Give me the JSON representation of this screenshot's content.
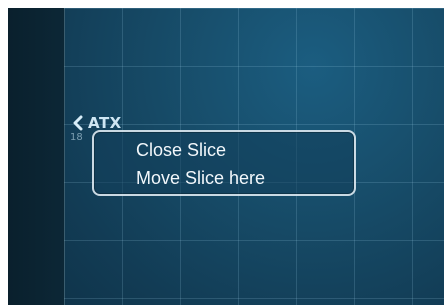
{
  "canvas": {
    "background_colors": [
      "#1b5d80",
      "#174d6a",
      "#123c55",
      "#0e3045"
    ]
  },
  "slice_tag": {
    "label": "ATX",
    "sub_label": "18"
  },
  "context_menu": {
    "items": [
      {
        "label": "Close Slice"
      },
      {
        "label": "Move Slice here"
      }
    ]
  }
}
